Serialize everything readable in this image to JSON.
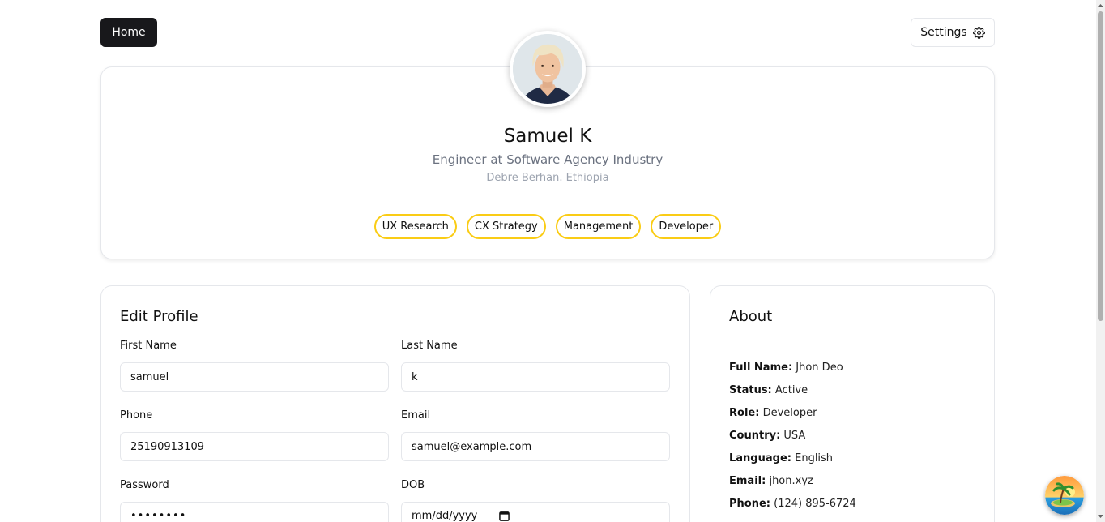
{
  "nav": {
    "home_label": "Home",
    "settings_label": "Settings",
    "settings_icon": "gear-icon"
  },
  "profile": {
    "name": "Samuel K",
    "title": "Engineer at Software Agency Industry",
    "location": "Debre Berhan. Ethiopia",
    "avatar": "avatar-photo",
    "tags": [
      "UX Research",
      "CX Strategy",
      "Management",
      "Developer"
    ],
    "tag_border_color": "#facc15"
  },
  "edit_profile": {
    "heading": "Edit Profile",
    "fields": {
      "first_name": {
        "label": "First Name",
        "value": "samuel"
      },
      "last_name": {
        "label": "Last Name",
        "value": "k"
      },
      "phone": {
        "label": "Phone",
        "value": "25190913109"
      },
      "email": {
        "label": "Email",
        "value": "samuel@example.com"
      },
      "password": {
        "label": "Password",
        "value": "••••••••"
      },
      "dob": {
        "label": "DOB",
        "placeholder": "mm/dd/yyyy"
      }
    }
  },
  "about": {
    "heading": "About",
    "rows": [
      {
        "key": "Full Name:",
        "value": "Jhon Deo"
      },
      {
        "key": "Status:",
        "value": "Active"
      },
      {
        "key": "Role:",
        "value": "Developer"
      },
      {
        "key": "Country:",
        "value": "USA"
      },
      {
        "key": "Language:",
        "value": "English"
      },
      {
        "key": "Email:",
        "value": "jhon.xyz"
      },
      {
        "key": "Phone:",
        "value": "(124) 895-6724"
      }
    ]
  },
  "floating_button_icon": "island-icon",
  "colors": {
    "primary_button": "#18181b",
    "accent": "#facc15"
  }
}
